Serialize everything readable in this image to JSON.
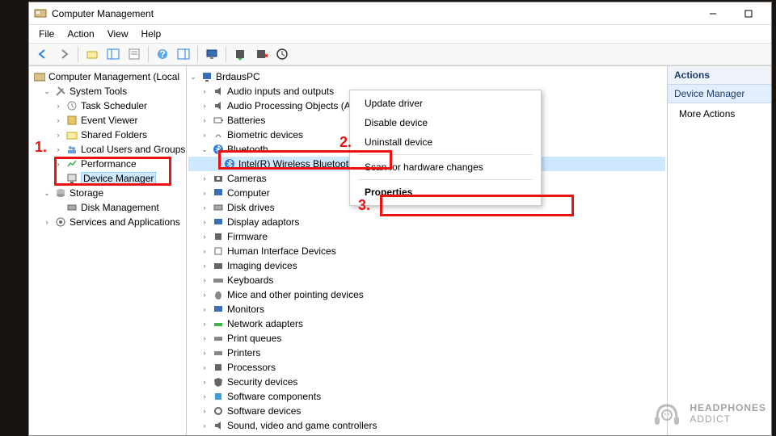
{
  "window": {
    "title": "Computer Management"
  },
  "menu": {
    "file": "File",
    "action": "Action",
    "view": "View",
    "help": "Help"
  },
  "left_tree": {
    "root": "Computer Management (Local",
    "system_tools": "System Tools",
    "task_scheduler": "Task Scheduler",
    "event_viewer": "Event Viewer",
    "shared_folders": "Shared Folders",
    "local_users": "Local Users and Groups",
    "performance": "Performance",
    "device_manager": "Device Manager",
    "storage": "Storage",
    "disk_management": "Disk Management",
    "services_apps": "Services and Applications"
  },
  "center_tree": {
    "root": "BrdausPC",
    "audio_io": "Audio inputs and outputs",
    "apos": "Audio Processing Objects (APOs)",
    "batteries": "Batteries",
    "biometric": "Biometric devices",
    "bluetooth": "Bluetooth",
    "bt_device": "Intel(R) Wireless Bluetooth(R)",
    "cameras": "Cameras",
    "computer": "Computer",
    "disk_drives": "Disk drives",
    "display": "Display adaptors",
    "firmware": "Firmware",
    "hid": "Human Interface Devices",
    "imaging": "Imaging devices",
    "keyboards": "Keyboards",
    "mice": "Mice and other pointing devices",
    "monitors": "Monitors",
    "network": "Network adapters",
    "print_queues": "Print queues",
    "printers": "Printers",
    "processors": "Processors",
    "security": "Security devices",
    "sw_components": "Software components",
    "sw_devices": "Software devices",
    "sound": "Sound, video and game controllers"
  },
  "context_menu": {
    "update": "Update driver",
    "disable": "Disable device",
    "uninstall": "Uninstall device",
    "scan": "Scan for hardware changes",
    "properties": "Properties"
  },
  "actions": {
    "header": "Actions",
    "subheader": "Device Manager",
    "more": "More Actions"
  },
  "callouts": {
    "one": "1.",
    "two": "2.",
    "three": "3."
  },
  "watermark": {
    "line1": "HEADPHONES",
    "line2": "ADDICT"
  }
}
